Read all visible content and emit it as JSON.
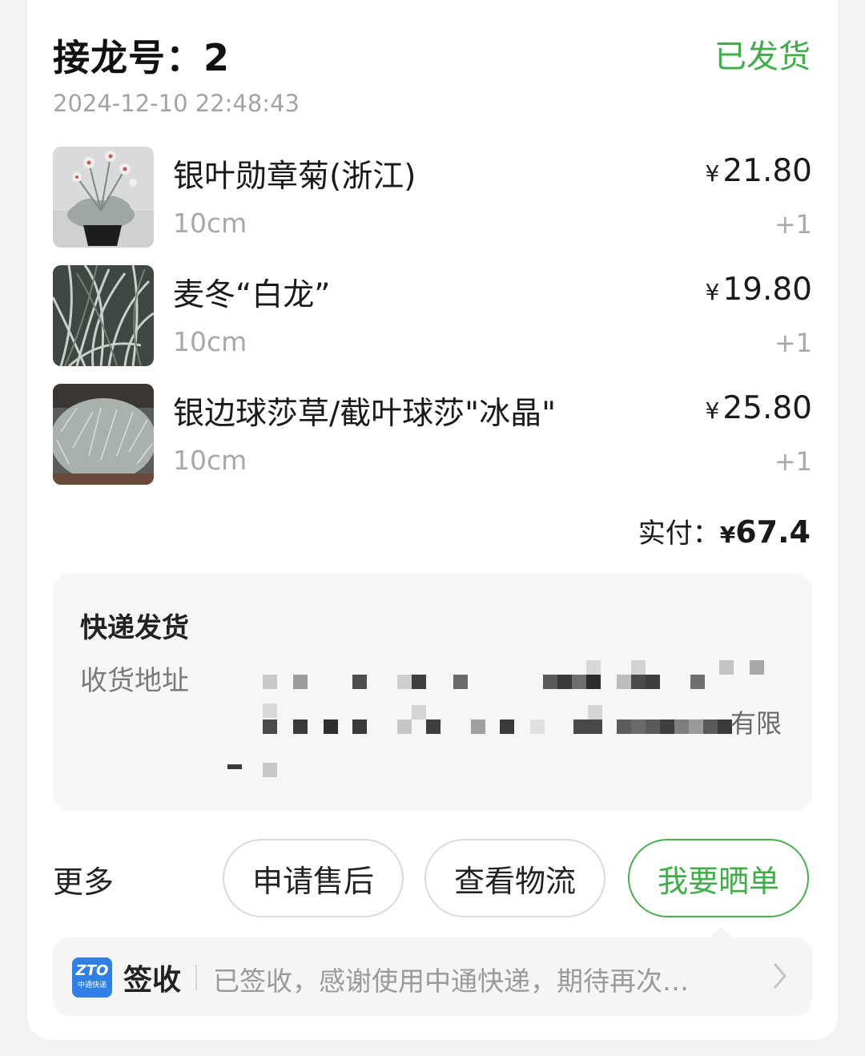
{
  "order": {
    "title": "接龙号：",
    "number": "2",
    "status": "已发货",
    "time": "2024-12-10 22:48:43"
  },
  "items": [
    {
      "name": "银叶勋章菊(浙江)",
      "spec": "10cm",
      "currency": "¥",
      "price": "21.80",
      "qty": "+1",
      "image": "white-daisy-plant-photo"
    },
    {
      "name": "麦冬“白龙”",
      "spec": "10cm",
      "currency": "¥",
      "price": "19.80",
      "qty": "+1",
      "image": "striped-grass-plant-photo"
    },
    {
      "name": "银边球莎草/截叶球莎\"冰晶\"",
      "spec": "10cm",
      "currency": "¥",
      "price": "25.80",
      "qty": "+1",
      "image": "silver-sedge-plant-photo"
    }
  ],
  "payment": {
    "label": "实付：",
    "currency": "¥",
    "amount": "67.4"
  },
  "shipping": {
    "title": "快递发货",
    "address_label": "收货地址",
    "address_tail": "有限"
  },
  "actions": {
    "more": "更多",
    "after_sale": "申请售后",
    "view_logistics": "查看物流",
    "share_review": "我要晒单"
  },
  "tracking": {
    "logo_text": "ZTO",
    "logo_sub": "中通快递",
    "status": "签收",
    "message": "已签收，感谢使用中通快递，期待再次…"
  },
  "colors": {
    "accent": "#3fae49",
    "logo": "#2f7fe6"
  }
}
